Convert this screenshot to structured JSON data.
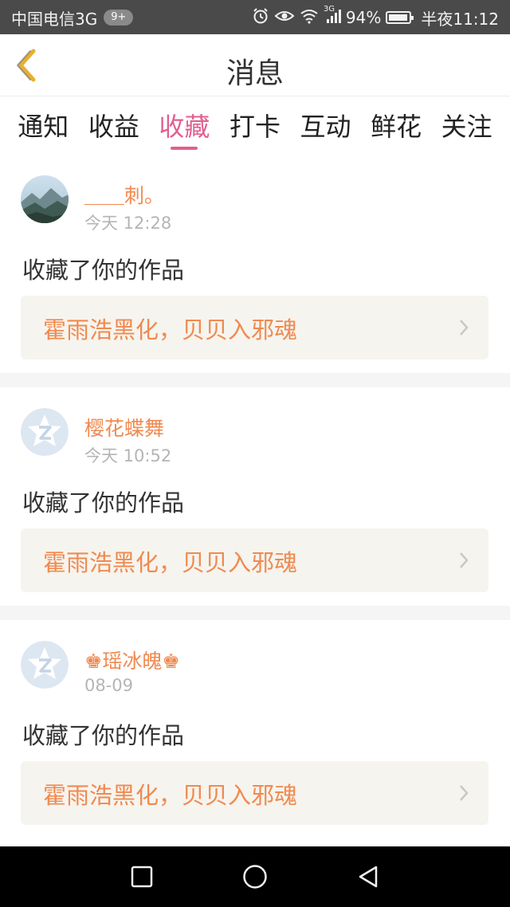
{
  "status_bar": {
    "carrier": "中国电信3G",
    "badge": "9+",
    "network_label": "3G",
    "battery_text": "94%",
    "battery_level": 0.94,
    "time": "半夜11:12",
    "icons": [
      "alarm-icon",
      "eye-icon",
      "wifi-icon",
      "signal-icon",
      "battery-icon"
    ]
  },
  "header": {
    "title": "消息",
    "back_icon": "chevron-left-icon"
  },
  "tabs": [
    {
      "label": "通知",
      "active": false
    },
    {
      "label": "收益",
      "active": false
    },
    {
      "label": "收藏",
      "active": true
    },
    {
      "label": "打卡",
      "active": false
    },
    {
      "label": "互动",
      "active": false
    },
    {
      "label": "鲜花",
      "active": false
    },
    {
      "label": "关注",
      "active": false
    }
  ],
  "messages": [
    {
      "username": "＿＿刺。",
      "time": "今天 12:28",
      "action": "收藏了你的作品",
      "work_title": "霍雨浩黑化，贝贝入邪魂",
      "avatar": "landscape-avatar"
    },
    {
      "username": "樱花蝶舞",
      "time": "今天 10:52",
      "action": "收藏了你的作品",
      "work_title": "霍雨浩黑化，贝贝入邪魂",
      "avatar": "default-avatar"
    },
    {
      "username": "♚瑶冰魄♚",
      "time": "08-09",
      "action": "收藏了你的作品",
      "work_title": "霍雨浩黑化，贝贝入邪魂",
      "avatar": "default-avatar"
    }
  ],
  "nav_bar": {
    "buttons": [
      "recent-apps-icon",
      "home-icon",
      "back-triangle-icon"
    ]
  },
  "colors": {
    "accent": "#e06090",
    "username": "#f08a50",
    "time": "#b5b5b5",
    "status_bar_bg": "#4a4a4a",
    "work_bg": "#f6f4ee",
    "back_icon": "#e8b030"
  }
}
